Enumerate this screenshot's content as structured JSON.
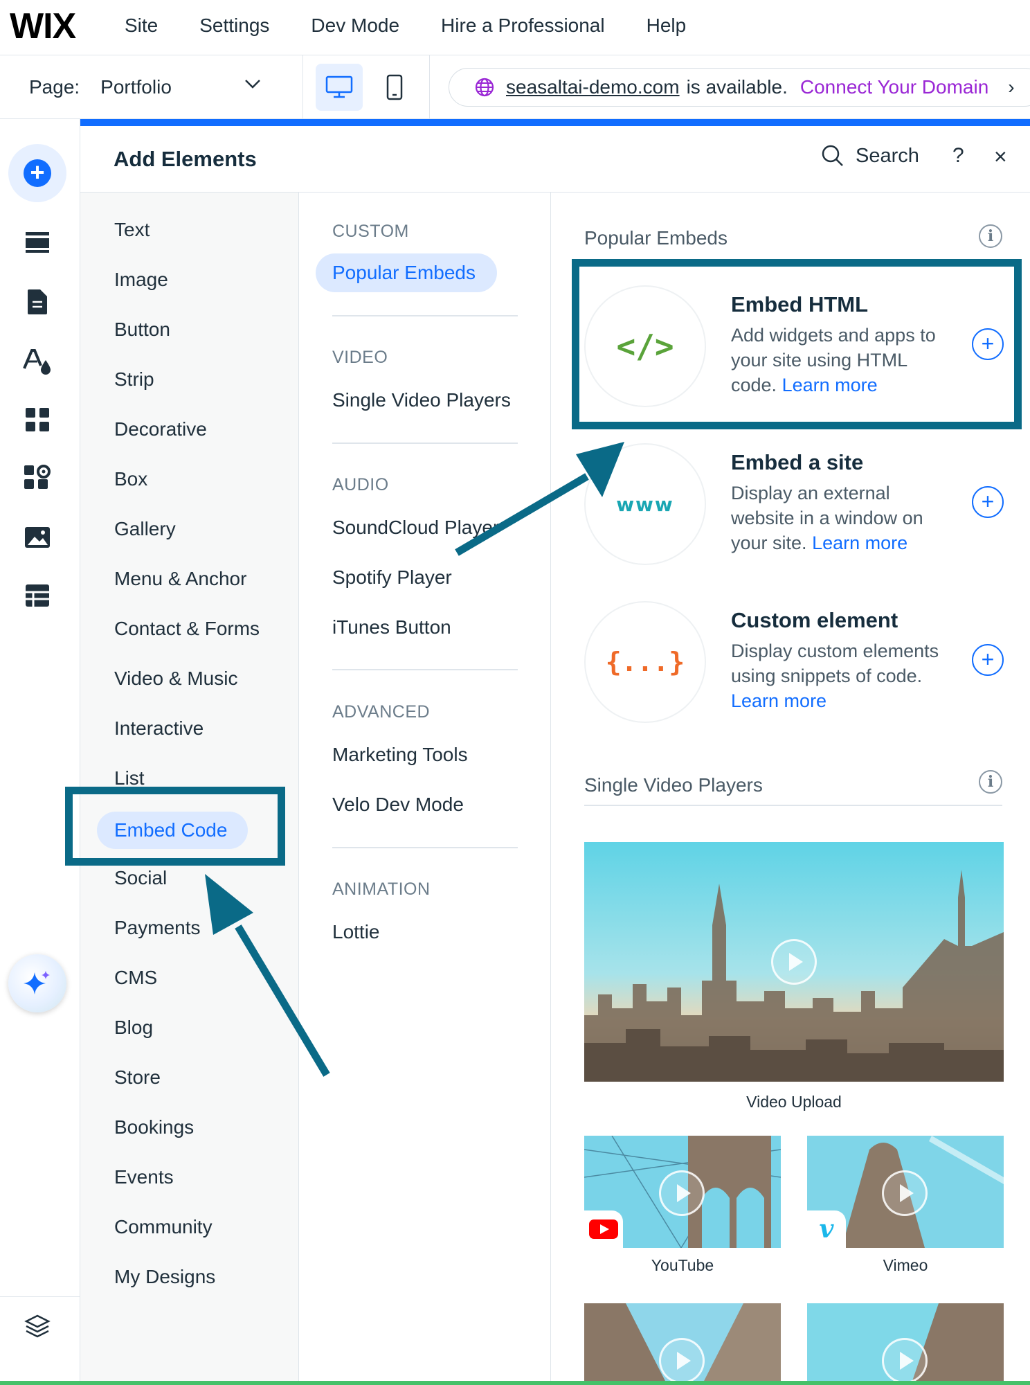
{
  "brand": {
    "logo": "WIX"
  },
  "top_menu": [
    "Site",
    "Settings",
    "Dev Mode",
    "Hire a Professional",
    "Help"
  ],
  "page_selector": {
    "label": "Page:",
    "value": "Portfolio"
  },
  "domain_banner": {
    "domain": "seasaltai-demo.com",
    "status": "is available.",
    "cta": "Connect Your Domain",
    "more": "›"
  },
  "panel": {
    "title": "Add Elements",
    "search_label": "Search",
    "help": "?",
    "close": "×"
  },
  "categories": [
    "Text",
    "Image",
    "Button",
    "Strip",
    "Decorative",
    "Box",
    "Gallery",
    "Menu & Anchor",
    "Contact & Forms",
    "Video & Music",
    "Interactive",
    "List",
    "Embed Code",
    "Social",
    "Payments",
    "CMS",
    "Blog",
    "Store",
    "Bookings",
    "Events",
    "Community",
    "My Designs"
  ],
  "selected_category": "Embed Code",
  "subcategories": {
    "custom": {
      "heading": "CUSTOM",
      "items": [
        "Popular Embeds"
      ]
    },
    "video": {
      "heading": "VIDEO",
      "items": [
        "Single Video Players"
      ]
    },
    "audio": {
      "heading": "AUDIO",
      "items": [
        "SoundCloud Player",
        "Spotify Player",
        "iTunes Button"
      ]
    },
    "advanced": {
      "heading": "ADVANCED",
      "items": [
        "Marketing Tools",
        "Velo Dev Mode"
      ]
    },
    "animation": {
      "heading": "ANIMATION",
      "items": [
        "Lottie"
      ]
    }
  },
  "content": {
    "popular_title": "Popular Embeds",
    "embeds": [
      {
        "title": "Embed HTML",
        "desc": "Add widgets and apps to your site using HTML code.",
        "link": "Learn more",
        "glyph": "</>",
        "glyph_color": "#5aa33a"
      },
      {
        "title": "Embed a site",
        "desc": "Display an external website in a window on your site.",
        "link": "Learn more",
        "glyph": "www",
        "glyph_color": "#1aa6b3"
      },
      {
        "title": "Custom element",
        "desc": "Display custom elements using snippets of code.",
        "link": "Learn more",
        "glyph": "{...}",
        "glyph_color": "#ef6a28"
      }
    ],
    "video_title": "Single Video Players",
    "videos": {
      "upload": "Video Upload",
      "youtube": "YouTube",
      "vimeo": "Vimeo"
    }
  },
  "colors": {
    "accent": "#116dff",
    "annotation": "#0a6a87",
    "domain_cta": "#9a27d5",
    "status_green": "#45c169"
  },
  "rail_icons": [
    "add-elements-icon",
    "sections-icon",
    "pages-icon",
    "theme-icon",
    "apps-icon",
    "app-market-icon",
    "media-icon",
    "cms-icon",
    "ai-assistant-icon",
    "layers-icon"
  ]
}
